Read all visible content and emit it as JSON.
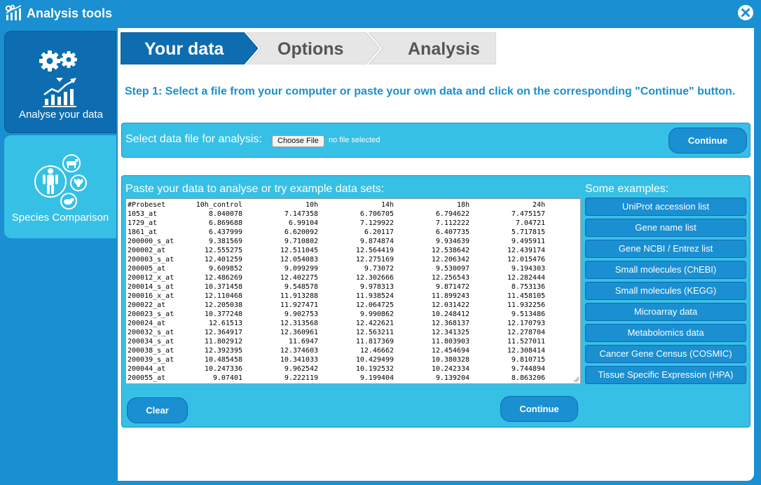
{
  "window": {
    "title": "Analysis tools",
    "logo_icon": "analysis-tools-logo-icon",
    "close_icon": "close-icon"
  },
  "sidebar": {
    "items": [
      {
        "label": "Analyse your data",
        "icon": "analyse-data-icon",
        "active": true
      },
      {
        "label": "Species Comparison",
        "icon": "species-comparison-icon",
        "active": false
      }
    ]
  },
  "steps": [
    {
      "label": "Your data",
      "active": true
    },
    {
      "label": "Options",
      "active": false
    },
    {
      "label": "Analysis",
      "active": false
    }
  ],
  "instructions": "Step 1: Select a file from your computer or paste your own data and click on the corresponding \"Continue\" button.",
  "file_select": {
    "label": "Select data file for analysis:",
    "choose_button": "Choose File",
    "file_status": "no file selected",
    "continue_button": "Continue"
  },
  "paste": {
    "label": "Paste your data to analyse or try example data sets:",
    "columns": [
      "#Probeset",
      "10h_control",
      "10h",
      "14h",
      "18h",
      "24h"
    ],
    "rows": [
      [
        "1053_at",
        "8.040078",
        "7.147358",
        "6.706705",
        "6.794622",
        "7.475157"
      ],
      [
        "1729_at",
        "6.869688",
        "6.99104",
        "7.129922",
        "7.112222",
        "7.04721"
      ],
      [
        "1861_at",
        "6.437999",
        "6.620092",
        "6.20117",
        "6.407735",
        "5.717815"
      ],
      [
        "200000_s_at",
        "9.381569",
        "9.710802",
        "9.874874",
        "9.934639",
        "9.495911"
      ],
      [
        "200002_at",
        "12.555275",
        "12.511045",
        "12.564419",
        "12.538642",
        "12.439174"
      ],
      [
        "200003_s_at",
        "12.401259",
        "12.054083",
        "12.275169",
        "12.206342",
        "12.015476"
      ],
      [
        "200005_at",
        "9.609852",
        "9.099299",
        "9.73072",
        "9.530097",
        "9.194303"
      ],
      [
        "200012_x_at",
        "12.486269",
        "12.402275",
        "12.302666",
        "12.256543",
        "12.282444"
      ],
      [
        "200014_s_at",
        "10.371458",
        "9.548578",
        "9.978313",
        "9.871472",
        "8.753136"
      ],
      [
        "200016_x_at",
        "12.110468",
        "11.913288",
        "11.938524",
        "11.899243",
        "11.458105"
      ],
      [
        "200022_at",
        "12.205038",
        "11.927471",
        "12.064725",
        "12.031422",
        "11.932256"
      ],
      [
        "200023_s_at",
        "10.377248",
        "9.902753",
        "9.990862",
        "10.248412",
        "9.513486"
      ],
      [
        "200024_at",
        "12.61513",
        "12.313568",
        "12.422621",
        "12.368137",
        "12.170793"
      ],
      [
        "200032_s_at",
        "12.364917",
        "12.360961",
        "12.563211",
        "12.341325",
        "12.278704"
      ],
      [
        "200034_s_at",
        "11.802912",
        "11.6947",
        "11.817369",
        "11.803903",
        "11.527011"
      ],
      [
        "200038_s_at",
        "12.392395",
        "12.374603",
        "12.46662",
        "12.454694",
        "12.308414"
      ],
      [
        "200039_s_at",
        "10.485458",
        "10.341033",
        "10.429499",
        "10.380328",
        "9.810715"
      ],
      [
        "200044_at",
        "10.247336",
        "9.962542",
        "10.192532",
        "10.242334",
        "9.744894"
      ],
      [
        "200055_at",
        "9.07401",
        "9.222119",
        "9.199404",
        "9.139204",
        "8.863206"
      ]
    ],
    "clear_button": "Clear",
    "continue_button": "Continue"
  },
  "examples": {
    "label": "Some examples:",
    "items": [
      "UniProt accession list",
      "Gene name list",
      "Gene NCBI / Entrez list",
      "Small molecules (ChEBI)",
      "Small molecules (KEGG)",
      "Microarray data",
      "Metabolomics data",
      "Cancer Gene Census (COSMIC)",
      "Tissue Specific Expression (HPA)"
    ]
  },
  "colors": {
    "primary": "#1a8fd1",
    "dark": "#0d6db0",
    "panel": "#37c0e6",
    "step_inactive": "#e6e6e6"
  }
}
